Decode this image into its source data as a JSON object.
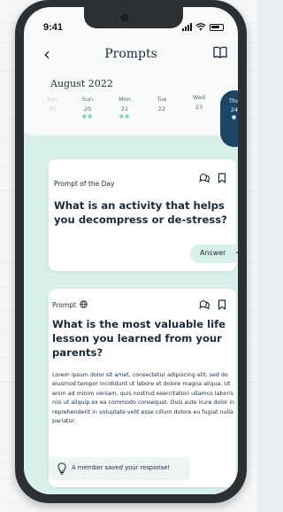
{
  "status": {
    "time": "9:41"
  },
  "header": {
    "title": "Prompts"
  },
  "calendar": {
    "month": "August 2022",
    "days": [
      {
        "name": "Sun",
        "date": "30",
        "muted": true,
        "dots": ""
      },
      {
        "name": "Sun",
        "date": "20",
        "muted": false,
        "dots": "●●"
      },
      {
        "name": "Mon",
        "date": "21",
        "muted": false,
        "dots": "●●"
      },
      {
        "name": "Tue",
        "date": "22",
        "muted": false,
        "dots": ""
      },
      {
        "name": "Wed",
        "date": "23",
        "muted": false,
        "dots": ""
      },
      {
        "name": "Thu",
        "date": "24",
        "muted": false,
        "dots": "●",
        "active": true
      }
    ]
  },
  "prompt_of_day": {
    "label": "Prompt of the Day",
    "question": "What is an activity that helps you decompress or de-stress?",
    "answer_label": "Answer",
    "answer_arrow": "→"
  },
  "prompt_card": {
    "label": "Prompt",
    "question": "What is the most valuable life lesson you learned from your parents?",
    "body": "Lorem ipsum dolor sit amet, consectetur adipiscing elit, sed do eiusmod tempor incididunt ut labore et dolore magna aliqua. Ut enim ad minim veniam, quis nostrud exercitation ullamco laboris nisi ut aliquip ex ea commodo consequat. Duis aute irure dolor in reprehenderit in voluptate velit esse cillum dolore eu fugiat nulla pariatur."
  },
  "toast": {
    "message": "A member saved your response!"
  },
  "colors": {
    "navy": "#1f4566",
    "mint": "#d9efea",
    "dot": "#8fd2bf"
  }
}
